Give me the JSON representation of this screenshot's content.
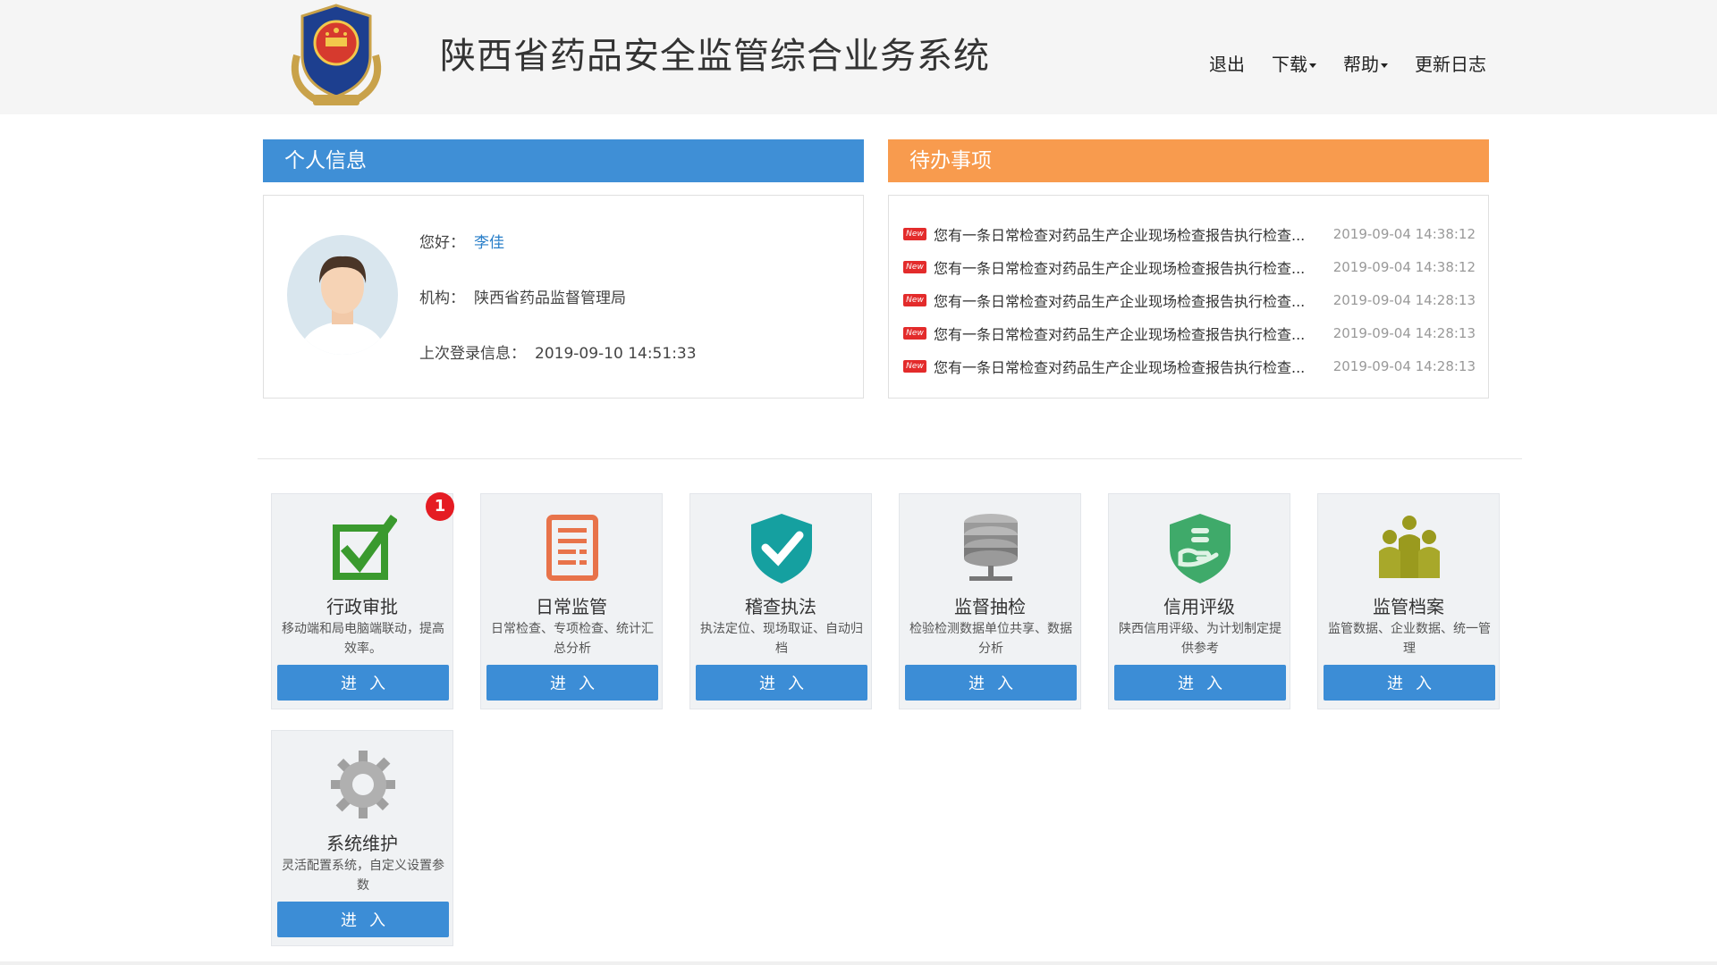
{
  "header": {
    "title": "陕西省药品安全监管综合业务系统",
    "nav": [
      {
        "label": "退出",
        "dropdown": false
      },
      {
        "label": "下载",
        "dropdown": true
      },
      {
        "label": "帮助",
        "dropdown": true
      },
      {
        "label": "更新日志",
        "dropdown": false
      }
    ]
  },
  "personal": {
    "title": "个人信息",
    "greeting_label": "您好：",
    "user_name": "李佳",
    "org_label": "机构：",
    "org_value": "陕西省药品监督管理局",
    "last_login_label": "上次登录信息：",
    "last_login_value": "2019-09-10 14:51:33"
  },
  "todo": {
    "title": "待办事项",
    "badge_text": "New",
    "items": [
      {
        "text": "您有一条日常检查对药品生产企业现场检查报告执行检查...",
        "time": "2019-09-04 14:38:12"
      },
      {
        "text": "您有一条日常检查对药品生产企业现场检查报告执行检查...",
        "time": "2019-09-04 14:38:12"
      },
      {
        "text": "您有一条日常检查对药品生产企业现场检查报告执行检查...",
        "time": "2019-09-04 14:28:13"
      },
      {
        "text": "您有一条日常检查对药品生产企业现场检查报告执行检查...",
        "time": "2019-09-04 14:28:13"
      },
      {
        "text": "您有一条日常检查对药品生产企业现场检查报告执行检查...",
        "time": "2019-09-04 14:28:13"
      }
    ]
  },
  "modules": [
    {
      "name": "行政审批",
      "desc": "移动端和局电脑端联动，提高效率。",
      "enter": "进入",
      "badge": "1",
      "icon": "checkbox-icon",
      "color": "#3a9a2e"
    },
    {
      "name": "日常监管",
      "desc": "日常检查、专项检查、统计汇总分析",
      "enter": "进入",
      "icon": "document-icon",
      "color": "#e8734a"
    },
    {
      "name": "稽查执法",
      "desc": "执法定位、现场取证、自动归档",
      "enter": "进入",
      "icon": "shield-check-icon",
      "color": "#15a0a0"
    },
    {
      "name": "监督抽检",
      "desc": "检验检测数据单位共享、数据分析",
      "enter": "进入",
      "icon": "database-icon",
      "color": "#8a8a8a"
    },
    {
      "name": "信用评级",
      "desc": "陕西信用评级、为计划制定提供参考",
      "enter": "进入",
      "icon": "credit-shield-icon",
      "color": "#3faa6a"
    },
    {
      "name": "监管档案",
      "desc": "监管数据、企业数据、统一管理",
      "enter": "进入",
      "icon": "people-icon",
      "color": "#9a9a1e"
    },
    {
      "name": "系统维护",
      "desc": "灵活配置系统，自定义设置参数",
      "enter": "进入",
      "icon": "gear-icon",
      "color": "#a0a0a0"
    }
  ]
}
